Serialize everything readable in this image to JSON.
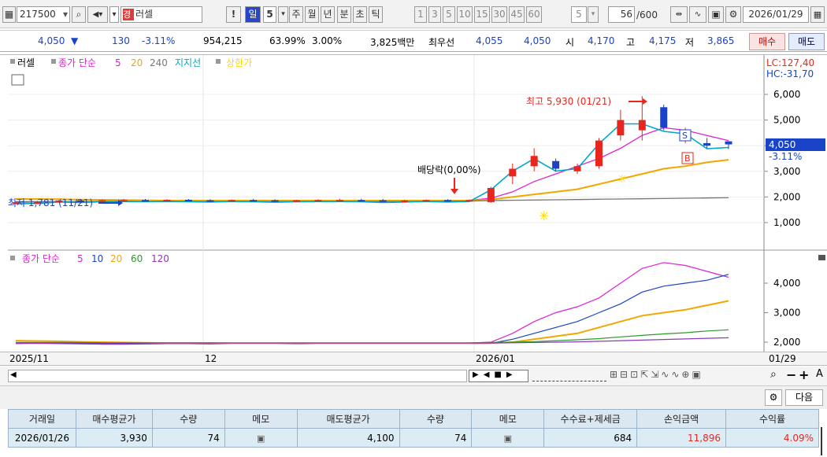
{
  "toolbar": {
    "code": "217500",
    "market_badge": "경",
    "stock_name": "러셀",
    "excl": "!",
    "periods": [
      "일",
      "5",
      "주",
      "월",
      "년",
      "분",
      "초",
      "틱"
    ],
    "intervals": [
      "1",
      "3",
      "5",
      "10",
      "15",
      "30",
      "45",
      "60"
    ],
    "interval_value": "5",
    "count_value": "56",
    "count_max": "/600",
    "date": "2026/01/29"
  },
  "quote": {
    "price": "4,050",
    "arrow": "▼",
    "change": "130",
    "change_pct": "-3.11%",
    "volume": "954,215",
    "vol_ratio": "63.99%",
    "turnover": "3.00%",
    "amount": "3,825백만",
    "best_label": "최우선",
    "best_ask": "4,055",
    "best_bid": "4,050",
    "open_label": "시",
    "open": "4,170",
    "high_label": "고",
    "high": "4,175",
    "low_label": "저",
    "low": "3,865",
    "buy_label": "매수",
    "sell_label": "매도"
  },
  "chart_top": {
    "legend_name": "러셀",
    "legend_ma_label": "종가 단순",
    "legend_ma": [
      "5",
      "20",
      "240"
    ],
    "legend_support": "지지선",
    "legend_upper": "상한가",
    "lc": "LC:127,40",
    "hc": "HC:-31,70",
    "yticks": [
      "6,000",
      "5,000",
      "4,000",
      "3,000",
      "2,000",
      "1,000"
    ],
    "price_box": "4,050",
    "price_box_pct": "-3.11%",
    "high_annot": "최고 5,930 (01/21)",
    "low_annot": "최저 1,781 (11/21)",
    "dividend_annot": "배당락(0,00%)",
    "sell_tag": "S",
    "buy_tag": "B"
  },
  "chart_bottom": {
    "legend_ma_label": "종가 단순",
    "legend_ma": [
      "5",
      "10",
      "20",
      "60",
      "120"
    ],
    "yticks": [
      "4,000",
      "3,000",
      "2,000"
    ]
  },
  "xaxis": {
    "labels": [
      "2025/11",
      "12",
      "2026/01",
      "01/29"
    ]
  },
  "footer": {
    "next_label": "다음"
  },
  "trade_table": {
    "headers": [
      "거래일",
      "매수평균가",
      "수량",
      "메모",
      "매도평균가",
      "수량",
      "메모",
      "수수료+제세금",
      "손익금액",
      "수익률"
    ],
    "rows": [
      [
        "2026/01/26",
        "3,930",
        "74",
        "",
        "4,100",
        "74",
        "",
        "684",
        "11,896",
        "4.09%"
      ]
    ]
  },
  "colors": {
    "up": "#e8261e",
    "down": "#1a44c8",
    "ma5": "#e020d0",
    "ma20": "#f0a800",
    "ma240": "#777777",
    "support": "#00a8c8",
    "upper": "#ffd800"
  },
  "chart_data": [
    {
      "type": "candlestick",
      "y_ticks": [
        1000,
        2000,
        3000,
        4000,
        5000,
        6000
      ],
      "x_labels": [
        "2025/11",
        "12",
        "2026/01",
        "01/29"
      ],
      "annotations": [
        "최고 5,930 (01/21)",
        "최저 1,781 (11/21)",
        "배당락(0,00%)"
      ],
      "last_close": 4050,
      "change_pct": -3.11,
      "candles": [
        {
          "o": 1780,
          "h": 1820,
          "l": 1760,
          "c": 1790
        },
        {
          "o": 1790,
          "h": 1850,
          "l": 1770,
          "c": 1800
        },
        {
          "o": 1800,
          "h": 1880,
          "l": 1790,
          "c": 1860
        },
        {
          "o": 1860,
          "h": 1900,
          "l": 1820,
          "c": 1840
        },
        {
          "o": 1840,
          "h": 1900,
          "l": 1820,
          "c": 1870
        },
        {
          "o": 1870,
          "h": 1920,
          "l": 1840,
          "c": 1880
        },
        {
          "o": 1880,
          "h": 1920,
          "l": 1850,
          "c": 1870
        },
        {
          "o": 1870,
          "h": 1910,
          "l": 1850,
          "c": 1890
        },
        {
          "o": 1890,
          "h": 1920,
          "l": 1860,
          "c": 1870
        },
        {
          "o": 1870,
          "h": 1910,
          "l": 1840,
          "c": 1860
        },
        {
          "o": 1860,
          "h": 1900,
          "l": 1840,
          "c": 1880
        },
        {
          "o": 1880,
          "h": 1920,
          "l": 1860,
          "c": 1870
        },
        {
          "o": 1870,
          "h": 1910,
          "l": 1840,
          "c": 1850
        },
        {
          "o": 1850,
          "h": 1890,
          "l": 1830,
          "c": 1870
        },
        {
          "o": 1870,
          "h": 1910,
          "l": 1850,
          "c": 1880
        },
        {
          "o": 1880,
          "h": 1930,
          "l": 1860,
          "c": 1880
        },
        {
          "o": 1880,
          "h": 1930,
          "l": 1850,
          "c": 1870
        },
        {
          "o": 1870,
          "h": 1920,
          "l": 1830,
          "c": 1840
        },
        {
          "o": 1840,
          "h": 1890,
          "l": 1820,
          "c": 1860
        },
        {
          "o": 1860,
          "h": 1900,
          "l": 1840,
          "c": 1880
        },
        {
          "o": 1880,
          "h": 1910,
          "l": 1850,
          "c": 1860
        },
        {
          "o": 1860,
          "h": 1900,
          "l": 1840,
          "c": 1880
        },
        {
          "o": 1800,
          "h": 2400,
          "l": 1780,
          "c": 2350
        },
        {
          "o": 2800,
          "h": 3300,
          "l": 2500,
          "c": 3100
        },
        {
          "o": 3200,
          "h": 3900,
          "l": 3000,
          "c": 3600
        },
        {
          "o": 3400,
          "h": 3500,
          "l": 3000,
          "c": 3100
        },
        {
          "o": 3000,
          "h": 3300,
          "l": 2900,
          "c": 3200
        },
        {
          "o": 3200,
          "h": 4300,
          "l": 3100,
          "c": 4200
        },
        {
          "o": 4400,
          "h": 5400,
          "l": 4200,
          "c": 5000
        },
        {
          "o": 4600,
          "h": 5930,
          "l": 4200,
          "c": 5000
        },
        {
          "o": 5500,
          "h": 5600,
          "l": 4600,
          "c": 4700
        },
        {
          "o": 4200,
          "h": 4700,
          "l": 4100,
          "c": 4600
        },
        {
          "o": 4100,
          "h": 4300,
          "l": 3900,
          "c": 4000
        },
        {
          "o": 4170,
          "h": 4175,
          "l": 3865,
          "c": 4050
        }
      ],
      "series": [
        {
          "name": "5",
          "values": [
            1790,
            1800,
            1810,
            1820,
            1830,
            1840,
            1860,
            1870,
            1870,
            1870,
            1870,
            1870,
            1870,
            1870,
            1870,
            1870,
            1870,
            1870,
            1870,
            1870,
            1870,
            1870,
            1950,
            2200,
            2600,
            2900,
            3200,
            3500,
            3900,
            4400,
            4700,
            4600,
            4400,
            4200
          ]
        },
        {
          "name": "20",
          "values": [
            1920,
            1920,
            1910,
            1900,
            1890,
            1880,
            1870,
            1860,
            1860,
            1860,
            1860,
            1860,
            1860,
            1860,
            1860,
            1860,
            1860,
            1860,
            1860,
            1860,
            1860,
            1860,
            1900,
            2000,
            2100,
            2200,
            2300,
            2500,
            2700,
            2900,
            3100,
            3200,
            3350,
            3450
          ]
        },
        {
          "name": "240",
          "values": [
            1820,
            1820,
            1820,
            1820,
            1820,
            1820,
            1820,
            1820,
            1820,
            1820,
            1820,
            1820,
            1820,
            1820,
            1820,
            1820,
            1820,
            1820,
            1820,
            1820,
            1830,
            1840,
            1860,
            1870,
            1880,
            1890,
            1900,
            1910,
            1920,
            1930,
            1940,
            1950,
            1960,
            1970
          ]
        }
      ]
    },
    {
      "type": "line",
      "y_ticks": [
        2000,
        3000,
        4000
      ],
      "series": [
        {
          "name": "5",
          "values": [
            1950,
            1960,
            1950,
            1940,
            1930,
            1930,
            1940,
            1950,
            1950,
            1940,
            1950,
            1960,
            1950,
            1940,
            1950,
            1960,
            1950,
            1950,
            1960,
            1960,
            1960,
            1970,
            2000,
            2300,
            2700,
            3000,
            3200,
            3500,
            4000,
            4500,
            4700,
            4600,
            4400,
            4200
          ]
        },
        {
          "name": "10",
          "values": [
            1980,
            1980,
            1970,
            1960,
            1950,
            1950,
            1950,
            1950,
            1950,
            1950,
            1950,
            1950,
            1950,
            1950,
            1950,
            1950,
            1950,
            1950,
            1950,
            1950,
            1950,
            1950,
            1960,
            2100,
            2300,
            2500,
            2700,
            3000,
            3300,
            3700,
            3900,
            4000,
            4100,
            4300
          ]
        },
        {
          "name": "20",
          "values": [
            2050,
            2040,
            2030,
            2010,
            2000,
            1990,
            1980,
            1970,
            1970,
            1970,
            1960,
            1960,
            1960,
            1960,
            1960,
            1960,
            1960,
            1960,
            1960,
            1960,
            1960,
            1960,
            1970,
            2000,
            2100,
            2200,
            2300,
            2500,
            2700,
            2900,
            3000,
            3100,
            3250,
            3400
          ]
        },
        {
          "name": "60",
          "values": [
            1990,
            1990,
            1990,
            1990,
            1980,
            1980,
            1980,
            1980,
            1980,
            1980,
            1980,
            1980,
            1980,
            1980,
            1980,
            1980,
            1980,
            1980,
            1980,
            1980,
            1980,
            1980,
            1990,
            2000,
            2020,
            2050,
            2080,
            2120,
            2180,
            2230,
            2280,
            2320,
            2380,
            2420
          ]
        },
        {
          "name": "120",
          "values": [
            1970,
            1970,
            1970,
            1970,
            1970,
            1970,
            1970,
            1970,
            1970,
            1970,
            1970,
            1970,
            1970,
            1970,
            1970,
            1970,
            1970,
            1970,
            1970,
            1970,
            1970,
            1970,
            1970,
            1980,
            1990,
            2000,
            2010,
            2030,
            2050,
            2070,
            2090,
            2110,
            2130,
            2150
          ]
        }
      ]
    }
  ]
}
